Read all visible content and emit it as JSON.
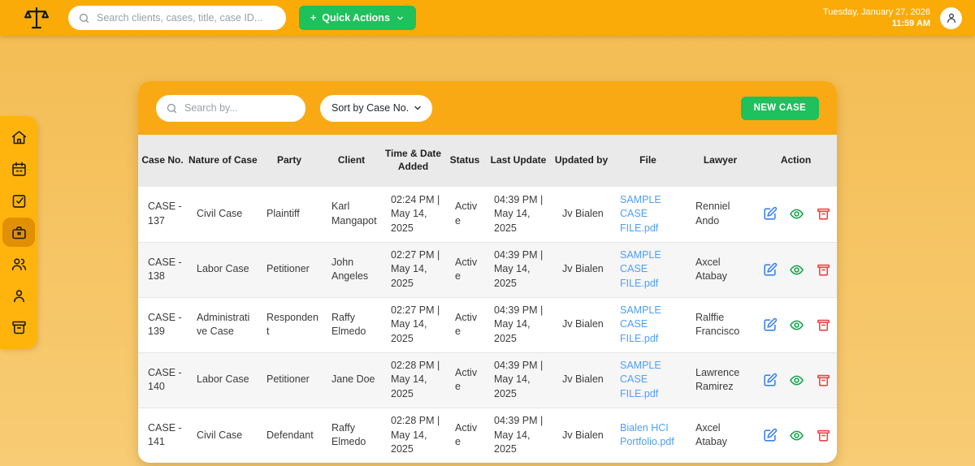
{
  "theme": {
    "topbar_amber": "#FAAB08",
    "sidebar_amber": "#FFB40D",
    "active_item_orange": "#E18F03",
    "page_bg_top": "#F3BC52",
    "page_bg_bottom": "#F8CC74",
    "card_header_amber": "#F9A913",
    "accent_green": "#1EC15B",
    "link_blue": "#4DA0F7",
    "edit_blue": "#3B82F6",
    "view_green": "#16A34A",
    "delete_red": "#EF4444",
    "table_header_gray": "#EAEAEA"
  },
  "topbar": {
    "search_placeholder": "Search clients, cases, title, case ID...",
    "quick_actions_plus": "+",
    "quick_actions_label": "Quick Actions",
    "date": "Tuesday, January 27, 2026",
    "time": "11:59 AM"
  },
  "sidebar": {
    "items": [
      {
        "id": "home",
        "icon": "home",
        "active": false
      },
      {
        "id": "calendar",
        "icon": "calendar",
        "active": false
      },
      {
        "id": "tasks",
        "icon": "check-square",
        "active": false
      },
      {
        "id": "cases",
        "icon": "briefcase",
        "active": true
      },
      {
        "id": "clients",
        "icon": "users",
        "active": false
      },
      {
        "id": "profile",
        "icon": "user",
        "active": false
      },
      {
        "id": "archive",
        "icon": "archive",
        "active": false
      }
    ]
  },
  "toolbar": {
    "search_placeholder": "Search by...",
    "sort_value": "Sort by Case No.",
    "new_case_label": "NEW CASE"
  },
  "table": {
    "columns": [
      "Case No.",
      "Nature of Case",
      "Party",
      "Client",
      "Time & Date Added",
      "Status",
      "Last Update",
      "Updated by",
      "File",
      "Lawyer",
      "Action"
    ],
    "action_icons": [
      "edit",
      "view",
      "delete"
    ],
    "rows": [
      {
        "case_no": "CASE - 137",
        "nature": "Civil Case",
        "party": "Plaintiff",
        "client": "Karl Mangapot",
        "time_added": "02:24 PM | May 14, 2025",
        "status": "Active",
        "last_update": "04:39 PM | May 14, 2025",
        "updated_by": "Jv Bialen",
        "file": "SAMPLE CASE FILE.pdf",
        "lawyer": "Renniel Ando"
      },
      {
        "case_no": "CASE - 138",
        "nature": "Labor Case",
        "party": "Petitioner",
        "client": "John Angeles",
        "time_added": "02:27 PM | May 14, 2025",
        "status": "Active",
        "last_update": "04:39 PM | May 14, 2025",
        "updated_by": "Jv Bialen",
        "file": "SAMPLE CASE FILE.pdf",
        "lawyer": "Axcel Atabay"
      },
      {
        "case_no": "CASE - 139",
        "nature": "Administrative Case",
        "party": "Respondent",
        "client": "Raffy Elmedo",
        "time_added": "02:27 PM | May 14, 2025",
        "status": "Active",
        "last_update": "04:39 PM | May 14, 2025",
        "updated_by": "Jv Bialen",
        "file": "SAMPLE CASE FILE.pdf",
        "lawyer": "Ralffie Francisco"
      },
      {
        "case_no": "CASE - 140",
        "nature": "Labor Case",
        "party": "Petitioner",
        "client": "Jane Doe",
        "time_added": "02:28 PM | May 14, 2025",
        "status": "Active",
        "last_update": "04:39 PM | May 14, 2025",
        "updated_by": "Jv Bialen",
        "file": "SAMPLE CASE FILE.pdf",
        "lawyer": "Lawrence Ramirez"
      },
      {
        "case_no": "CASE - 141",
        "nature": "Civil Case",
        "party": "Defendant",
        "client": "Raffy Elmedo",
        "time_added": "02:28 PM | May 14, 2025",
        "status": "Active",
        "last_update": "04:39 PM | May 14, 2025",
        "updated_by": "Jv Bialen",
        "file": "Bialen HCI Portfolio.pdf",
        "lawyer": "Axcel Atabay"
      }
    ]
  }
}
